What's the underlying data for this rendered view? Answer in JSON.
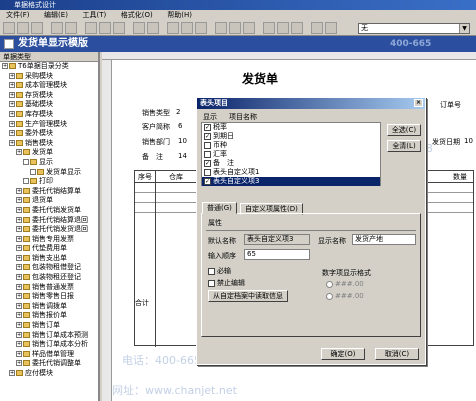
{
  "window": {
    "title": "单据格式设计"
  },
  "menu": [
    "文件(F)",
    "编辑(E)",
    "工具(T)",
    "格式化(O)",
    "帮助(H)"
  ],
  "toolbar": {
    "font_combo": "无"
  },
  "app": {
    "title": "发货单显示模版"
  },
  "tree": {
    "header": "单据类型",
    "items": [
      {
        "label": "T6单据目录分类",
        "indent": 0
      },
      {
        "label": "采购模块",
        "indent": 1
      },
      {
        "label": "成本管理模块",
        "indent": 1
      },
      {
        "label": "存货模块",
        "indent": 1
      },
      {
        "label": "基础模块",
        "indent": 1
      },
      {
        "label": "库存模块",
        "indent": 1
      },
      {
        "label": "生产管理模块",
        "indent": 1
      },
      {
        "label": "委外模块",
        "indent": 1
      },
      {
        "label": "销售模块",
        "indent": 1
      },
      {
        "label": "发货单",
        "indent": 2
      },
      {
        "label": "显示",
        "indent": 3
      },
      {
        "label": "发货单显示",
        "indent": 4
      },
      {
        "label": "打印",
        "indent": 3
      },
      {
        "label": "委托代销结算单",
        "indent": 2
      },
      {
        "label": "退货单",
        "indent": 2
      },
      {
        "label": "委托代销发货单",
        "indent": 2
      },
      {
        "label": "委托代销结算退回",
        "indent": 2
      },
      {
        "label": "委托代销发货退回",
        "indent": 2
      },
      {
        "label": "销售专用发票",
        "indent": 2
      },
      {
        "label": "代垫费用单",
        "indent": 2
      },
      {
        "label": "销售支出单",
        "indent": 2
      },
      {
        "label": "包装物租借登记",
        "indent": 2
      },
      {
        "label": "包装物租还登记",
        "indent": 2
      },
      {
        "label": "销售普通发票",
        "indent": 2
      },
      {
        "label": "销售零售日报",
        "indent": 2
      },
      {
        "label": "销售调拨单",
        "indent": 2
      },
      {
        "label": "销售报价单",
        "indent": 2
      },
      {
        "label": "销售订单",
        "indent": 2
      },
      {
        "label": "销售订单成本预测",
        "indent": 2
      },
      {
        "label": "销售订单成本分析",
        "indent": 2
      },
      {
        "label": "样品借单管理",
        "indent": 2
      },
      {
        "label": "委托代销调整单",
        "indent": 2
      },
      {
        "label": "应付模块",
        "indent": 1
      }
    ]
  },
  "form": {
    "title": "发货单",
    "fields": [
      "销售类型",
      "客户简称",
      "销售部门",
      "备　注"
    ],
    "field_values": [
      "2",
      "6",
      "10",
      "14"
    ],
    "right_fields": [
      "订单号",
      "发货日期"
    ],
    "right_value": "10",
    "grid_headers": [
      "序号",
      "仓库",
      "数量"
    ],
    "total_label": "合计"
  },
  "dialog": {
    "title": "表头项目",
    "col_display": "显示",
    "col_name": "项目名称",
    "items": [
      {
        "label": "税率",
        "checked": true,
        "selected": false
      },
      {
        "label": "到期日",
        "checked": true,
        "selected": false
      },
      {
        "label": "币种",
        "checked": false,
        "selected": false
      },
      {
        "label": "汇率",
        "checked": false,
        "selected": false
      },
      {
        "label": "备　注",
        "checked": true,
        "selected": false
      },
      {
        "label": "表头自定义项1",
        "checked": false,
        "selected": false
      },
      {
        "label": "表头自定义项3",
        "checked": true,
        "selected": true
      }
    ],
    "btn_select_all": "全选(C)",
    "btn_clear_all": "全清(L)",
    "tabs": [
      "普通(G)",
      "自定义项属性(D)"
    ],
    "section": "属性",
    "default_name_label": "默认名称",
    "default_name_value": "表头自定义项3",
    "display_name_label": "显示名称",
    "display_name_value": "发货产地",
    "input_order_label": "输入顺序",
    "input_order_value": "65",
    "chk_required": "必输",
    "chk_disable_edit": "禁止编辑",
    "btn_from_archive": "从自定档案中读取信息",
    "numeric_format_label": "数字项显示格式",
    "format_opt1": "###.00",
    "format_opt2": "###.00",
    "btn_ok": "确定(O)",
    "btn_cancel": "取消(C)"
  },
  "watermark": {
    "phone": "电话：400-665-0028",
    "site": "网址：www.chanjet.net",
    "phone_short": "400-665"
  }
}
